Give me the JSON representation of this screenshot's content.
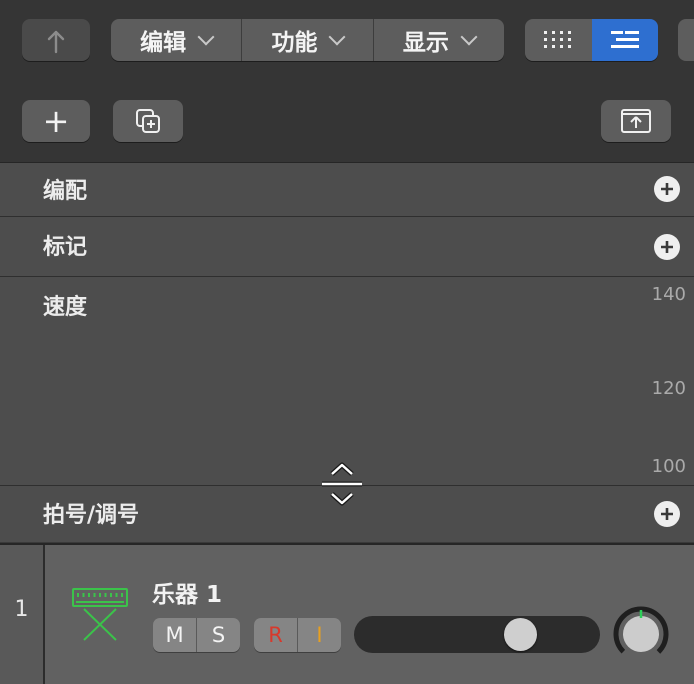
{
  "toolbar": {
    "back_icon": "up-arrow-back-icon",
    "menus": [
      {
        "label": "编辑"
      },
      {
        "label": "功能"
      },
      {
        "label": "显示"
      }
    ]
  },
  "row2": {
    "add_label": "+"
  },
  "global_tracks": {
    "arrangement": {
      "title": "编配"
    },
    "marker": {
      "title": "标记"
    },
    "tempo": {
      "title": "速度",
      "ticks": [
        "140",
        "120",
        "100"
      ]
    },
    "signature": {
      "title": "拍号/调号"
    }
  },
  "track": {
    "number": "1",
    "name": "乐器 1",
    "mute": "M",
    "solo": "S",
    "record": "R",
    "input": "I",
    "volume_level": 0.71,
    "icon_color": "#3bc34a",
    "record_color": "#d8392c",
    "input_color": "#e8a020"
  },
  "colors": {
    "accent": "#2e6fd0"
  }
}
